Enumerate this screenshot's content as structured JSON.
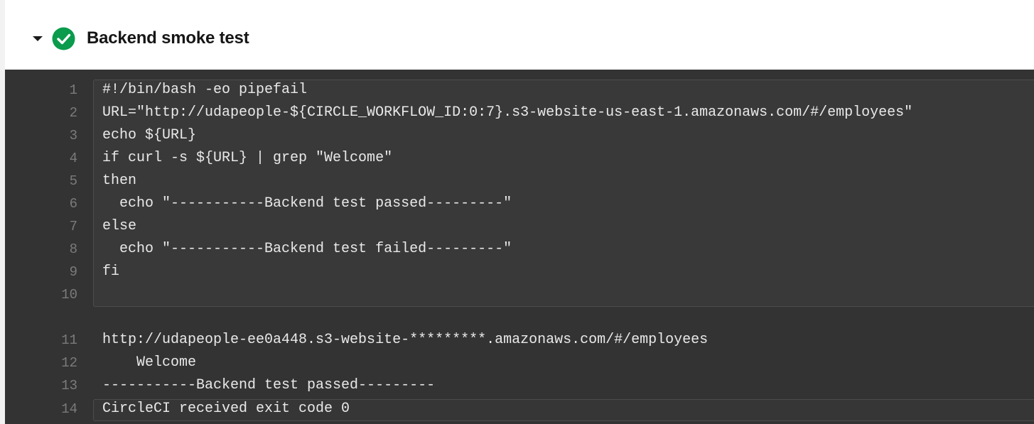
{
  "job": {
    "title": "Backend smoke test",
    "status": "success",
    "status_color": "#0a9b4c",
    "toggle_icon": "caret-down-icon",
    "status_icon": "check-circle-icon"
  },
  "command": {
    "lines": [
      {
        "num": "1",
        "text": "#!/bin/bash -eo pipefail"
      },
      {
        "num": "2",
        "text": "URL=\"http://udapeople-${CIRCLE_WORKFLOW_ID:0:7}.s3-website-us-east-1.amazonaws.com/#/employees\""
      },
      {
        "num": "3",
        "text": "echo ${URL}"
      },
      {
        "num": "4",
        "text": "if curl -s ${URL} | grep \"Welcome\""
      },
      {
        "num": "5",
        "text": "then"
      },
      {
        "num": "6",
        "text": "  echo \"-----------Backend test passed---------\""
      },
      {
        "num": "7",
        "text": "else"
      },
      {
        "num": "8",
        "text": "  echo \"-----------Backend test failed---------\""
      },
      {
        "num": "9",
        "text": "fi"
      },
      {
        "num": "10",
        "text": ""
      }
    ]
  },
  "output": {
    "lines": [
      {
        "num": "11",
        "text": "http://udapeople-ee0a448.s3-website-*********.amazonaws.com/#/employees"
      },
      {
        "num": "12",
        "text": "    Welcome"
      },
      {
        "num": "13",
        "text": "-----------Backend test passed---------"
      },
      {
        "num": "14",
        "text": "CircleCI received exit code 0"
      }
    ]
  }
}
